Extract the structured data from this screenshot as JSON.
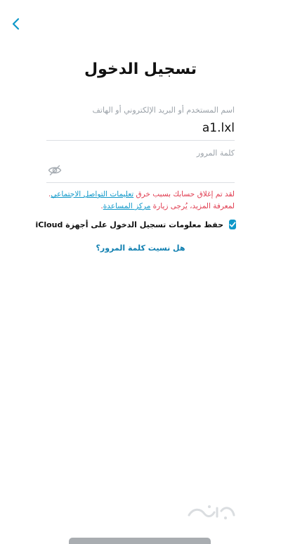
{
  "header": {
    "title": "تسجيل الدخول"
  },
  "username": {
    "label": "اسم المستخدم أو البريد الإلكتروني أو الهاتف",
    "value": "a1.lxl"
  },
  "password": {
    "label": "كلمة المرور",
    "value": ""
  },
  "error": {
    "line1_prefix": "لقد تم إغلاق حسابك بسبب خرق ",
    "line1_link": "تعليمات التواصل الاجتماعي",
    "line1_suffix": ".",
    "line2_prefix": "لمعرفة المزيد، يُرجى زيارة ",
    "line2_link": "مركز المساعدة",
    "line2_suffix": "."
  },
  "icloud": {
    "label": "حفظ معلومات تسجيل الدخول على أجهزة iCloud",
    "checked": true
  },
  "forgot_password": "هل نسيت كلمة المرور؟",
  "colors": {
    "accent": "#0f98c9",
    "error": "#e03a4e",
    "link": "#0f7fb0"
  }
}
